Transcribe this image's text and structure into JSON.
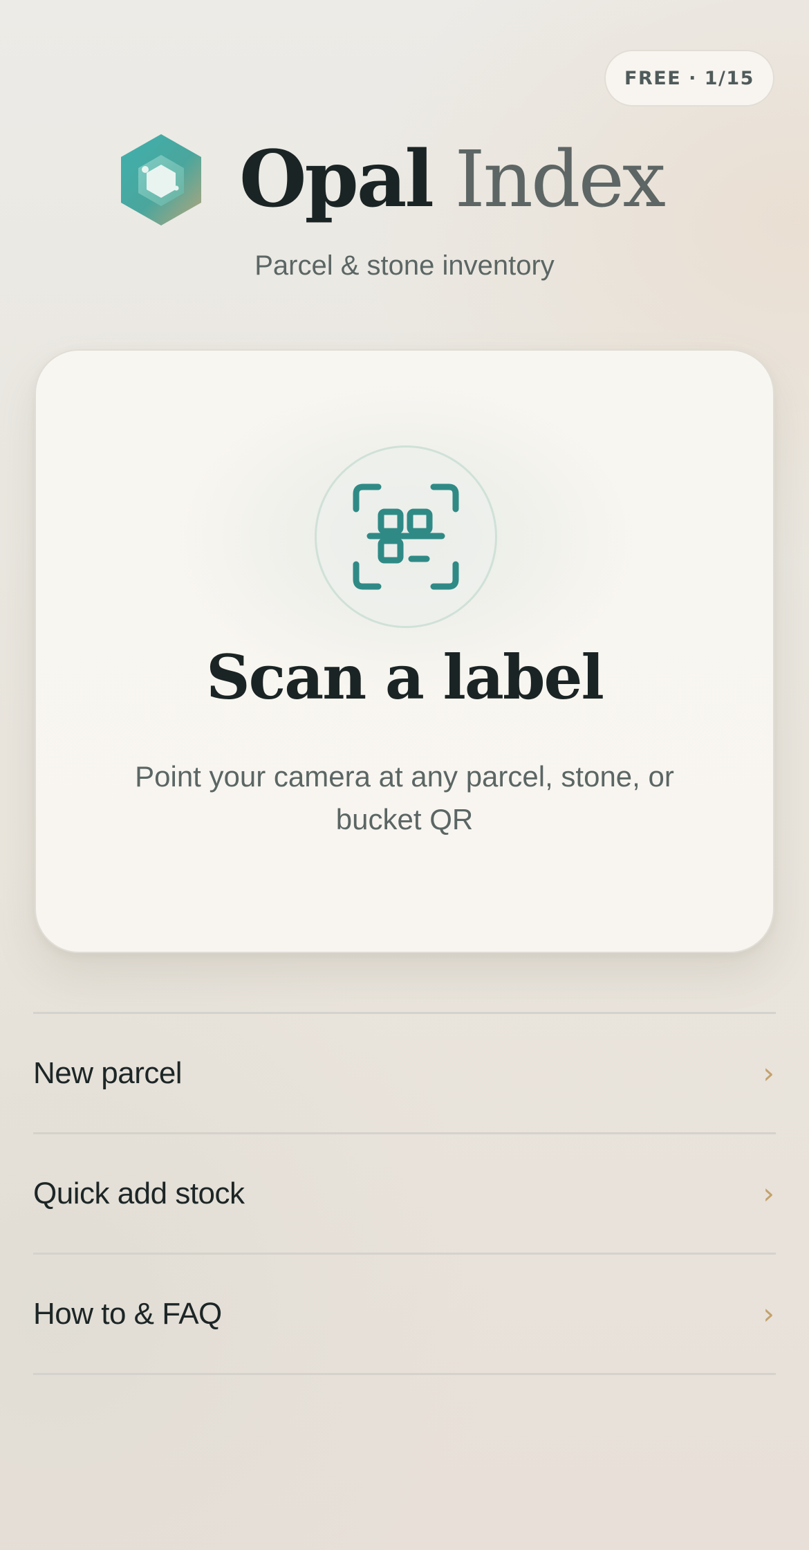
{
  "header": {
    "plan_badge": "FREE · 1/15",
    "app_title_part1": "Opal",
    "app_title_part2": "Index",
    "tagline": "Parcel & stone inventory",
    "logo_icon": "hexagon-gem-logo-icon"
  },
  "scan_card": {
    "icon": "qr-scan-icon",
    "title": "Scan a label",
    "description": "Point your camera at any parcel, stone, or bucket QR"
  },
  "menu": {
    "items": [
      {
        "label": "New parcel",
        "icon": "chevron-right-icon"
      },
      {
        "label": "Quick add stock",
        "icon": "chevron-right-icon"
      },
      {
        "label": "How to & FAQ",
        "icon": "chevron-right-icon"
      }
    ],
    "chevron": "›"
  },
  "colors": {
    "accent_teal": "#2f8a86",
    "chevron_gold": "#c3a26c",
    "text_dark": "#1b2424",
    "text_muted": "#5b6664"
  }
}
